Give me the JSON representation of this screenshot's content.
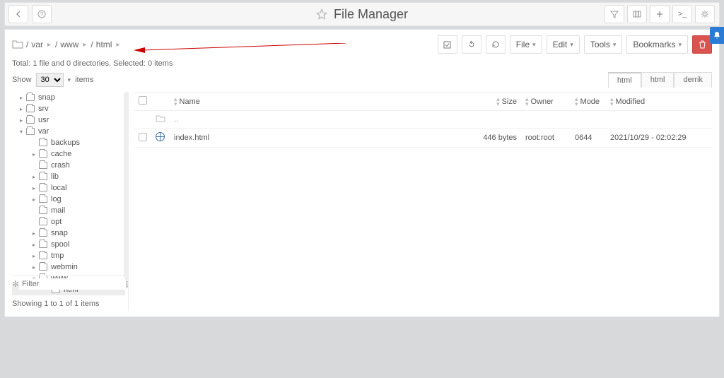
{
  "title": "File Manager",
  "breadcrumb": [
    "var",
    "www",
    "html"
  ],
  "status": "Total: 1 file and 0 directories. Selected: 0 items",
  "show": {
    "label": "Show",
    "per_page": "30",
    "items_label": "items"
  },
  "filter_placeholder": "Filter",
  "footer_count": "Showing 1 to 1 of 1 items",
  "toolbar": {
    "file": "File",
    "edit": "Edit",
    "tools": "Tools",
    "bookmarks": "Bookmarks"
  },
  "tabs": [
    {
      "label": "html",
      "active": true
    },
    {
      "label": "html",
      "active": false
    },
    {
      "label": "derrik",
      "active": false
    }
  ],
  "tree": [
    {
      "depth": 1,
      "caret": "closed",
      "name": "snap"
    },
    {
      "depth": 1,
      "caret": "closed",
      "name": "srv"
    },
    {
      "depth": 1,
      "caret": "closed",
      "name": "usr"
    },
    {
      "depth": 1,
      "caret": "open",
      "name": "var",
      "open": true
    },
    {
      "depth": 2,
      "caret": "none",
      "name": "backups"
    },
    {
      "depth": 2,
      "caret": "closed",
      "name": "cache"
    },
    {
      "depth": 2,
      "caret": "none",
      "name": "crash"
    },
    {
      "depth": 2,
      "caret": "closed",
      "name": "lib"
    },
    {
      "depth": 2,
      "caret": "closed",
      "name": "local"
    },
    {
      "depth": 2,
      "caret": "closed",
      "name": "log"
    },
    {
      "depth": 2,
      "caret": "none",
      "name": "mail"
    },
    {
      "depth": 2,
      "caret": "none",
      "name": "opt"
    },
    {
      "depth": 2,
      "caret": "closed",
      "name": "snap"
    },
    {
      "depth": 2,
      "caret": "closed",
      "name": "spool"
    },
    {
      "depth": 2,
      "caret": "closed",
      "name": "tmp"
    },
    {
      "depth": 2,
      "caret": "closed",
      "name": "webmin"
    },
    {
      "depth": 2,
      "caret": "open",
      "name": "www",
      "open": true
    },
    {
      "depth": 3,
      "caret": "none",
      "name": "html",
      "open": true,
      "selected": true
    }
  ],
  "columns": {
    "name": "Name",
    "size": "Size",
    "owner": "Owner",
    "mode": "Mode",
    "modified": "Modified"
  },
  "rows": [
    {
      "icon": "world",
      "name": "index.html",
      "size": "446 bytes",
      "owner": "root:root",
      "mode": "0644",
      "modified": "2021/10/29 - 02:02:29"
    }
  ],
  "colors": {
    "danger": "#d9534f",
    "accent": "#2a7bd6"
  }
}
